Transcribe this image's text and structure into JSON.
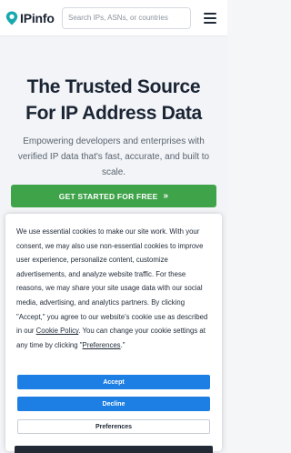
{
  "header": {
    "logo_text": "IPinfo",
    "search_placeholder": "Search IPs, ASNs, or countries"
  },
  "hero": {
    "title_line1": "The Trusted Source",
    "title_line2": "For IP Address Data",
    "subtitle": "Empowering developers and enterprises with verified IP data that's fast, accurate, and built to scale.",
    "cta_label": "GET STARTED FOR FREE",
    "cta_icon": "»"
  },
  "cookie": {
    "text_before_link": "We use essential cookies to make our site work. With your consent, we may also use non-essential cookies to improve user experience, personalize content, customize advertisements, and analyze website traffic. For these reasons, we may share your site usage data with our social media, advertising, and analytics partners. By clicking \"Accept,\" you agree to our website's cookie use as described in our ",
    "policy_link": "Cookie Policy",
    "text_after_link": ". You can change your cookie settings at any time by clicking \"",
    "prefs_link": "Preferences",
    "text_end": ".\"",
    "accept_label": "Accept",
    "decline_label": "Decline",
    "preferences_label": "Preferences"
  },
  "colors": {
    "brand_teal": "#1aa8b0",
    "cta_green": "#3fa34a",
    "button_blue": "#1d7fe3"
  }
}
